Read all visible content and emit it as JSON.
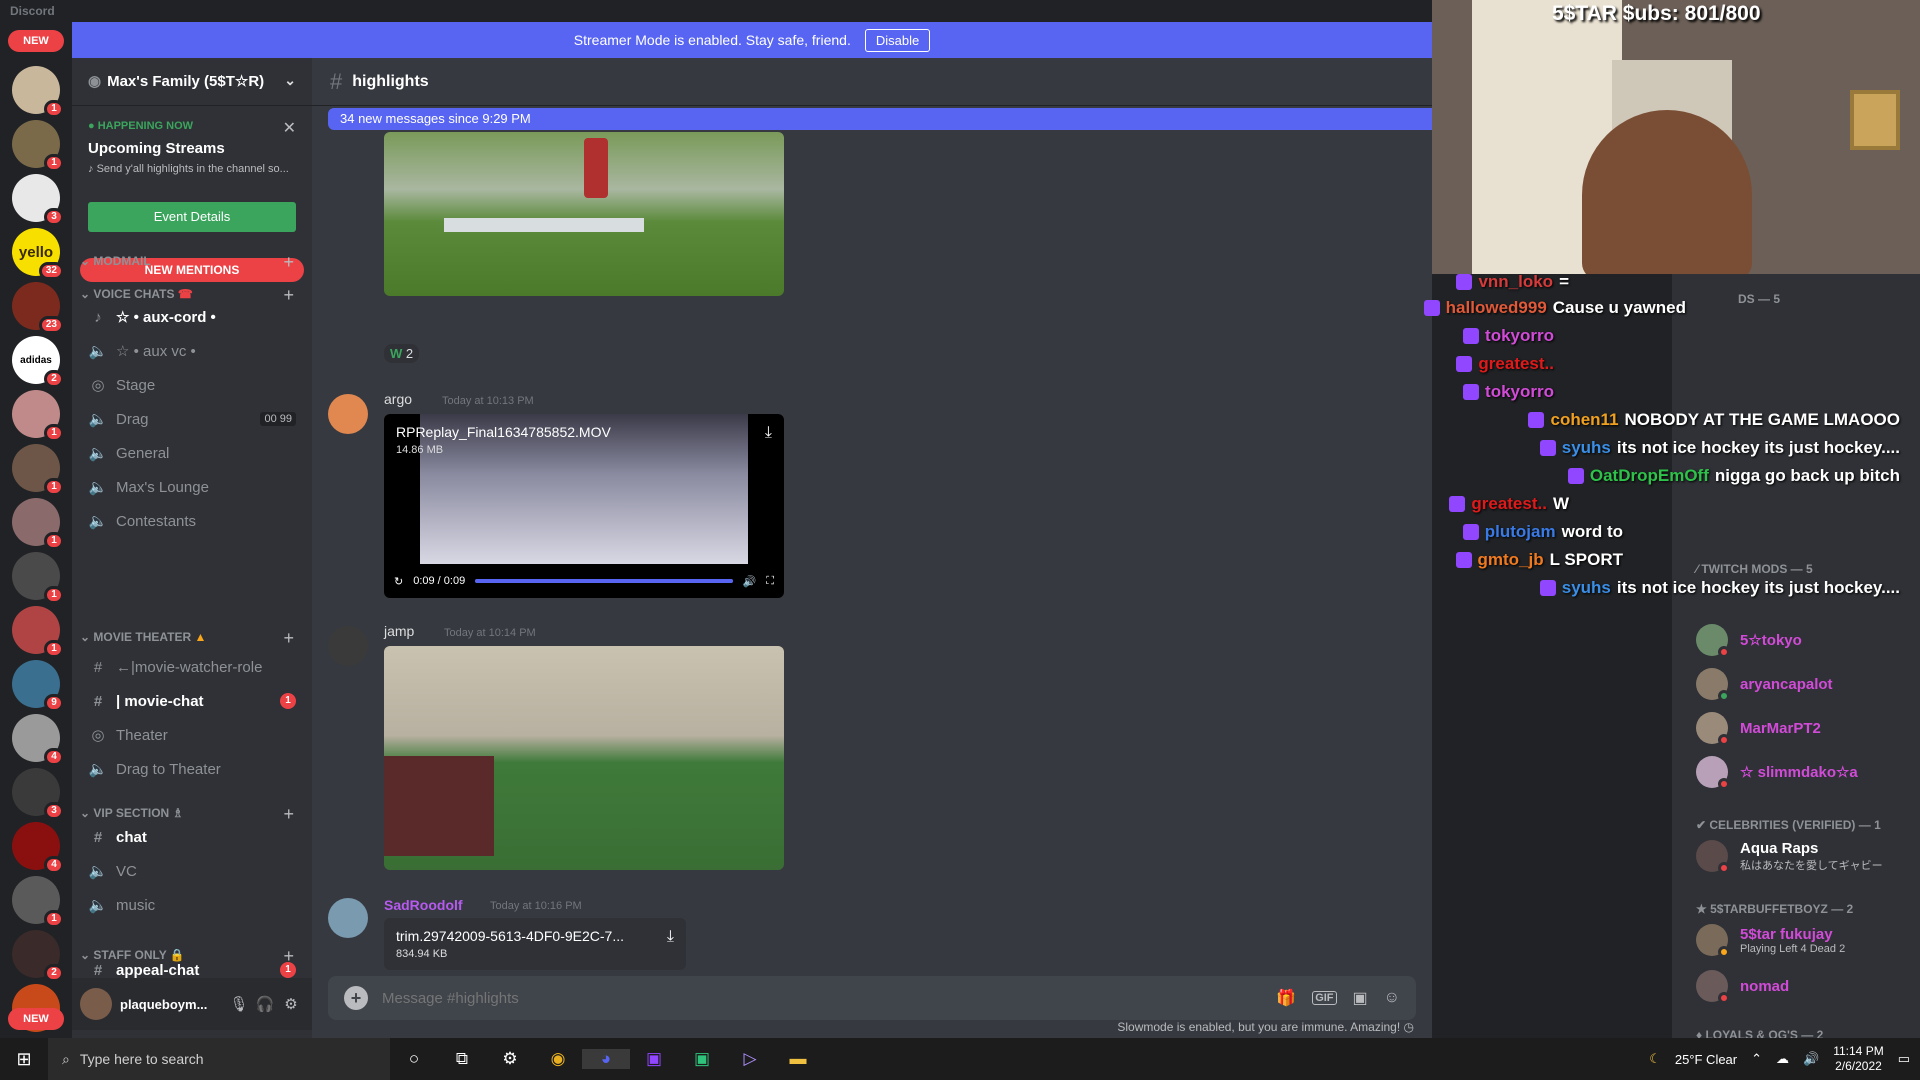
{
  "app_title": "Discord",
  "banner": {
    "text": "Streamer Mode is enabled. Stay safe, friend.",
    "button": "Disable"
  },
  "rail": {
    "new_top": "NEW",
    "new_bottom": "NEW",
    "servers": [
      {
        "badge": "1",
        "color": "#c9b79c",
        "label": ""
      },
      {
        "badge": "1",
        "color": "#7b6a4a",
        "label": ""
      },
      {
        "badge": "3",
        "color": "#e8e8e8",
        "label": ""
      },
      {
        "badge": "32",
        "color": "#f7e000",
        "label": "yello"
      },
      {
        "badge": "23",
        "color": "#7d2a1e",
        "label": ""
      },
      {
        "badge": "2",
        "color": "#ffffff",
        "label": "adidas"
      },
      {
        "badge": "1",
        "color": "#c08a8a",
        "label": ""
      },
      {
        "badge": "1",
        "color": "#6d5648",
        "label": ""
      },
      {
        "badge": "1",
        "color": "#8a6a6a",
        "label": ""
      },
      {
        "badge": "1",
        "color": "#4a4a4a",
        "label": ""
      },
      {
        "badge": "1",
        "color": "#b04444",
        "label": ""
      },
      {
        "badge": "9",
        "color": "#3a6f8f",
        "label": ""
      },
      {
        "badge": "4",
        "color": "#9a9a9a",
        "label": ""
      },
      {
        "badge": "3",
        "color": "#3a3a3a",
        "label": ""
      },
      {
        "badge": "4",
        "color": "#8a1010",
        "label": ""
      },
      {
        "badge": "1",
        "color": "#5a5a5a",
        "label": ""
      },
      {
        "badge": "2",
        "color": "#3a2a2a",
        "label": ""
      },
      {
        "badge": "",
        "color": "#c84a1a",
        "label": ""
      }
    ]
  },
  "server": {
    "name": "Max's Family (5$T☆R)"
  },
  "event": {
    "status": "HAPPENING NOW",
    "title": "Upcoming Streams",
    "desc": "Send y'all highlights in the channel so...",
    "button": "Event Details"
  },
  "new_mentions": "NEW MENTIONS",
  "categories": {
    "modmail": "MODMAIL",
    "voice": "VOICE CHATS",
    "movie": "MOVIE THEATER",
    "vip": "VIP SECTION",
    "staff": "STAFF ONLY"
  },
  "channels": {
    "aux_cord": "☆ • aux-cord •",
    "aux_vc": "☆ • aux vc •",
    "stage": "Stage",
    "drag": "Drag",
    "drag_counts": "00 99",
    "general": "General",
    "max_lounge": "Max's Lounge",
    "contestants": "Contestants",
    "movie_watcher": "←|movie-watcher-role",
    "movie_chat": "| movie-chat",
    "movie_chat_badge": "1",
    "theater": "Theater",
    "drag_to_theater": "Drag to Theater",
    "chat": "chat",
    "vc": "VC",
    "music": "music",
    "appeal": "appeal-chat",
    "appeal_badge": "1"
  },
  "user": {
    "name": "plaqueboym..."
  },
  "channel": {
    "name": "highlights",
    "new_messages": "34 new messages since 9:29 PM"
  },
  "messages": {
    "reaction": {
      "emoji": "W",
      "count": "2"
    },
    "argo": {
      "author": "argo",
      "time": "Today at 10:13 PM",
      "file": "RPReplay_Final1634785852.MOV",
      "size": "14.86 MB",
      "timecode": "0:09 / 0:09",
      "progress": 1.0
    },
    "jamp": {
      "author": "jamp",
      "time": "Today at 10:14 PM"
    },
    "sad": {
      "author": "SadRoodolf",
      "time": "Today at 10:16 PM",
      "file": "trim.29742009-5613-4DF0-9E2C-7...",
      "size": "834.94 KB"
    }
  },
  "composer": {
    "placeholder": "Message #highlights",
    "gif": "GIF"
  },
  "slowmode": "Slowmode is enabled, but you are immune. Amazing!",
  "overlay": {
    "subs": "5$TAR $ubs: 801/800"
  },
  "twitch_chat": [
    {
      "user": "vnn_loko",
      "msg": "=",
      "color": "#d63a3a"
    },
    {
      "user": "hallowed999",
      "msg": "Cause u yawned",
      "color": "#e05a3a"
    },
    {
      "user": "tokyorro",
      "msg": "",
      "color": "#d24bd8"
    },
    {
      "user": "greatest..",
      "msg": "",
      "color": "#e01a1a"
    },
    {
      "user": "tokyorro",
      "msg": "",
      "color": "#d24bd8"
    },
    {
      "user": "cohen11",
      "msg": "NOBODY AT THE GAME LMAOOO",
      "color": "#f0a020"
    },
    {
      "user": "syuhs",
      "msg": "its not ice hockey its just hockey....",
      "color": "#3a8ee6"
    },
    {
      "user": "OatDropEmOff",
      "msg": "nigga go back up bitch",
      "color": "#2ec24a"
    },
    {
      "user": "greatest..",
      "msg": "W",
      "color": "#e01a1a"
    },
    {
      "user": "plutojam",
      "msg": "word to",
      "color": "#3a7ae6"
    },
    {
      "user": "gmto_jb",
      "msg": "L SPORT",
      "color": "#f07a20"
    },
    {
      "user": "syuhs",
      "msg": "its not ice hockey its just hockey....",
      "color": "#3a8ee6"
    }
  ],
  "members": {
    "twitch_mods": "TWITCH MODS — 5",
    "mods": [
      {
        "name": "5☆tokyo",
        "color": "#d24bd8"
      },
      {
        "name": "aryancapalot",
        "color": "#d24bd8"
      },
      {
        "name": "MarMarPT2",
        "color": "#d24bd8"
      },
      {
        "name": "☆ slimmdako☆a",
        "color": "#d24bd8"
      }
    ],
    "celebs": "CELEBRITIES (VERIFIED) — 1",
    "celeb": {
      "name": "Aqua Raps",
      "sub": "私はあなたを愛してギャビー"
    },
    "starbuffet": "5$TARBUFFETBOYZ — 2",
    "buffet": [
      {
        "name": "5$tar fukujay",
        "sub": "Playing Left 4 Dead 2",
        "color": "#d24bd8"
      },
      {
        "name": "nomad",
        "sub": "",
        "color": "#d24bd8"
      }
    ],
    "loyals": "LOYALS & OG'S — 2",
    "ds": "DS — 5"
  },
  "taskbar": {
    "search": "Type here to search",
    "weather": "25°F  Clear",
    "time": "11:14 PM",
    "date": "2/6/2022"
  }
}
